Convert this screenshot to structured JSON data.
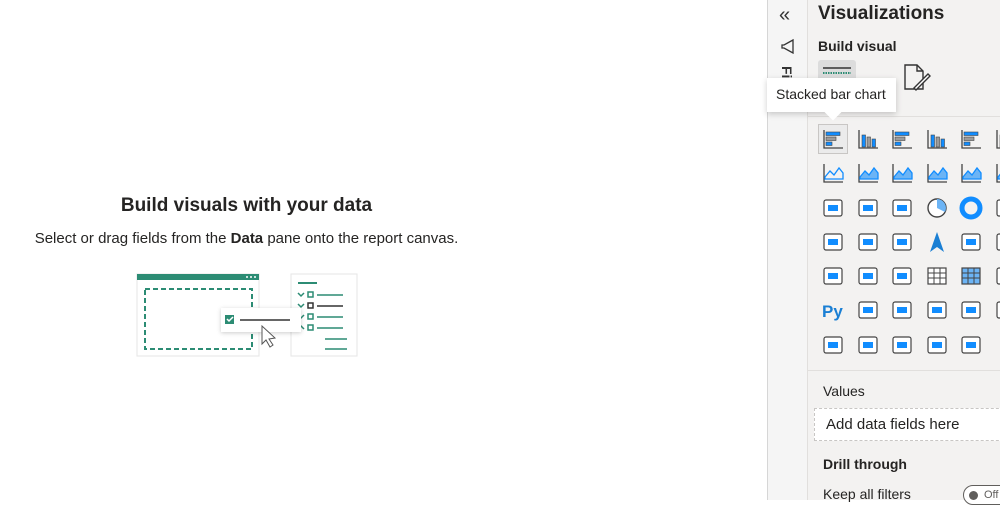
{
  "canvas": {
    "title": "Build visuals with your data",
    "subtitle_before": "Select or drag fields from the ",
    "subtitle_bold": "Data",
    "subtitle_after": " pane onto the report canvas."
  },
  "strip": {
    "collapse_icon": "«",
    "vertical_label": "Filters"
  },
  "pane": {
    "title": "Visualizations",
    "build_visual": "Build visual",
    "tooltip": "Stacked bar chart",
    "values_label": "Values",
    "values_placeholder": "Add data fields here",
    "drill_through": "Drill through",
    "keep_all_filters": "Keep all filters",
    "toggle_state": "Off"
  },
  "colors": {
    "accent": "#118dff",
    "teal": "#2c8c74",
    "pane_bg": "#f3f2f1"
  },
  "visuals": [
    "stacked-bar-chart",
    "stacked-column-chart",
    "clustered-bar-chart",
    "clustered-column-chart",
    "100-stacked-bar-chart",
    "100-stacked-column-chart",
    "line-chart",
    "area-chart",
    "stacked-area-chart",
    "line-and-stacked-column-chart",
    "line-and-clustered-column-chart",
    "ribbon-chart",
    "waterfall-chart",
    "funnel",
    "scatter-chart",
    "pie-chart",
    "donut-chart",
    "treemap",
    "map",
    "filled-map",
    "shape-map",
    "azure-map",
    "gauge",
    "card",
    "multi-row-card",
    "kpi",
    "slicer",
    "table",
    "matrix",
    "r-visual",
    "python-visual",
    "key-influencers",
    "decomposition-tree",
    "qna",
    "smart-narrative",
    "metrics",
    "paginated-report",
    "power-apps",
    "power-automate",
    "arcgis",
    "power-bi-goals",
    "more-visuals"
  ]
}
